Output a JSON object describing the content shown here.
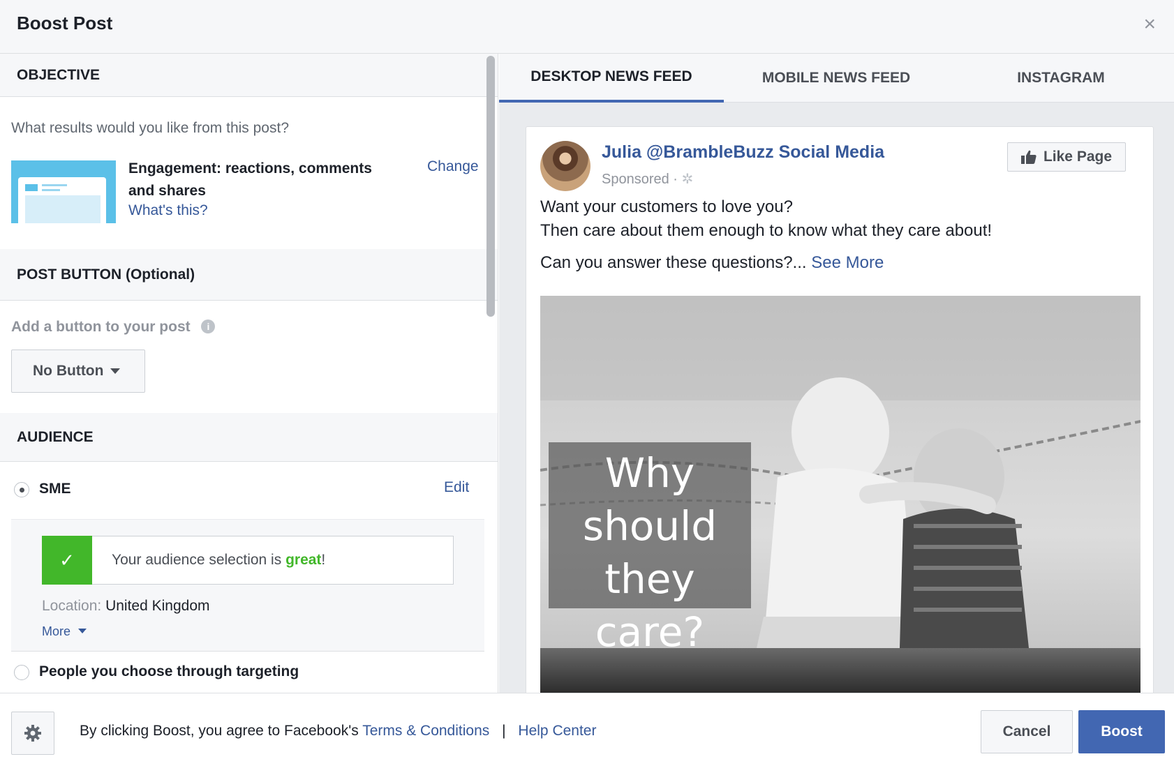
{
  "header": {
    "title": "Boost Post",
    "close_glyph": "×"
  },
  "objective": {
    "heading": "OBJECTIVE",
    "question": "What results would you like from this post?",
    "selection_line1": "Engagement: reactions, comments",
    "selection_line2": "and shares",
    "whats_this": "What's this?",
    "change": "Change",
    "thumbnail_icon": "engagement-thumbnail"
  },
  "post_button": {
    "heading": "POST BUTTON (Optional)",
    "label": "Add a button to your post",
    "info_icon": "info-icon",
    "dropdown_value": "No Button"
  },
  "audience": {
    "heading": "AUDIENCE",
    "option1": "SME",
    "edit": "Edit",
    "status_prefix": "Your audience selection is ",
    "status_word": "great",
    "status_suffix": "!",
    "location_label": "Location:",
    "location_value": "United Kingdom",
    "more": "More",
    "option2": "People you choose through targeting"
  },
  "preview": {
    "tabs": [
      "DESKTOP NEWS FEED",
      "MOBILE NEWS FEED",
      "INSTAGRAM"
    ],
    "active_tab": 0,
    "page_name": "Julia @BrambleBuzz Social Media",
    "sponsored": "Sponsored",
    "sponsored_sep": " · ",
    "like_button": "Like Page",
    "text_line1": "Want your customers to love you?",
    "text_line2": "Then care about them enough to know what they care about!",
    "text_line3": "Can you answer these questions?...",
    "see_more": "See More",
    "image_overlay": [
      "Why",
      "should",
      "they care?"
    ]
  },
  "footer": {
    "agree_prefix": "By clicking Boost, you agree to Facebook's ",
    "terms": "Terms & Conditions",
    "separator": "|",
    "help": "Help Center",
    "cancel": "Cancel",
    "boost": "Boost"
  },
  "colors": {
    "brand_blue": "#4267b2",
    "link_blue": "#365899",
    "success_green": "#42b72a",
    "panel_gray": "#f6f7f9",
    "border_gray": "#dddfe2"
  }
}
